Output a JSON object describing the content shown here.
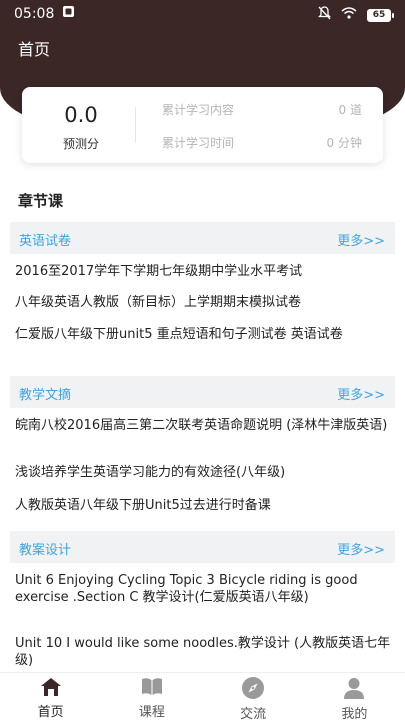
{
  "status_bar": {
    "time": "05:08",
    "battery": "65"
  },
  "header": {
    "title": "首页"
  },
  "stats": {
    "score": "0.0",
    "score_label": "预测分",
    "content_label": "累计学习内容",
    "content_value": "0 道",
    "time_label": "累计学习时间",
    "time_value": "0 分钟"
  },
  "section_title": "章节课",
  "categories": [
    {
      "title": "英语试卷",
      "more": "更多>>",
      "items": [
        "2016至2017学年下学期七年级期中学业水平考试",
        "八年级英语人教版（新目标）上学期期末模拟试卷",
        "仁爱版八年级下册unit5 重点短语和句子测试卷 英语试卷"
      ]
    },
    {
      "title": "教学文摘",
      "more": "更多>>",
      "items": [
        "皖南八校2016届高三第二次联考英语命题说明 (泽林牛津版英语)",
        "浅谈培养学生英语学习能力的有效途径(八年级)",
        "人教版英语八年级下册Unit5过去进行时备课"
      ]
    },
    {
      "title": "教案设计",
      "more": "更多>>",
      "items": [
        "Unit 6 Enjoying Cycling Topic 3 Bicycle riding is good exercise .Section C 教学设计(仁爱版英语八年级)",
        "Unit 10 I would like some noodles.教学设计 (人教版英语七年级)"
      ]
    }
  ],
  "tabs": [
    {
      "label": "首页",
      "icon": "home-icon",
      "active": true
    },
    {
      "label": "课程",
      "icon": "book-icon",
      "active": false
    },
    {
      "label": "交流",
      "icon": "compass-icon",
      "active": false
    },
    {
      "label": "我的",
      "icon": "user-icon",
      "active": false
    }
  ],
  "colors": {
    "header": "#3a2726",
    "accent": "#3da4e5",
    "category_bg": "#f1f2f4"
  }
}
